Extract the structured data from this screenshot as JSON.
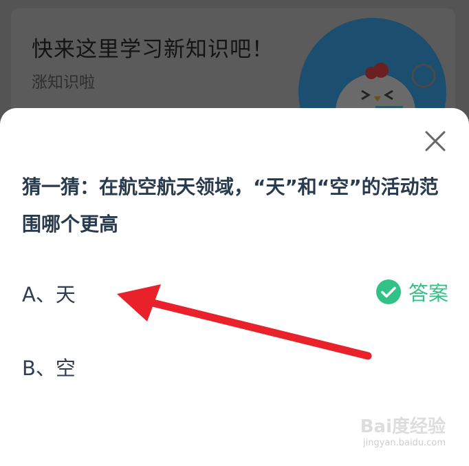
{
  "background_card": {
    "title": "快来这里学习新知识吧！",
    "subtitle": "涨知识啦"
  },
  "quiz": {
    "question": "猜一猜：在航空航天领域，“天”和“空”的活动范围哪个更高",
    "options": [
      {
        "label": "A、天",
        "is_answer": true
      },
      {
        "label": "B、空",
        "is_answer": false
      }
    ],
    "answer_label": "答案"
  },
  "icons": {
    "close": "close-icon",
    "check": "check-circle-icon",
    "annotation": "red-arrow"
  },
  "colors": {
    "overlay": "#545454",
    "sheet": "#ffffff",
    "question_text": "#283a4d",
    "answer_green": "#32c186",
    "arrow_red": "#e8212b"
  },
  "watermark": {
    "brand": "Bai度经验",
    "url": "jingyan.baidu.com"
  }
}
